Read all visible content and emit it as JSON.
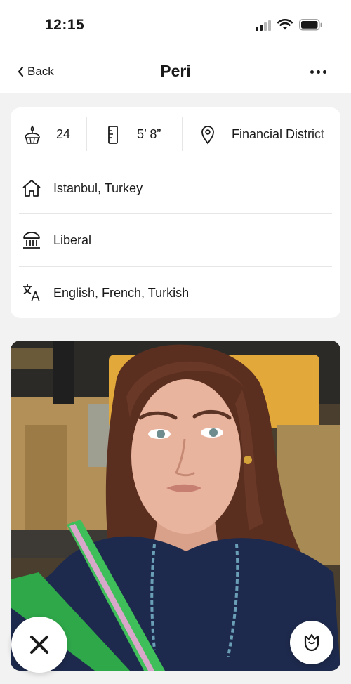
{
  "status_bar": {
    "time": "12:15",
    "icons": [
      "signal-icon",
      "wifi-icon",
      "battery-icon"
    ]
  },
  "nav": {
    "back_label": "Back",
    "title": "Peri",
    "more_icon": "more-dots-icon"
  },
  "info": {
    "age": {
      "icon": "cake-icon",
      "value": "24"
    },
    "height": {
      "icon": "ruler-icon",
      "value": "5’ 8”"
    },
    "location": {
      "icon": "location-pin-icon",
      "value": "Financial District"
    },
    "rows": [
      {
        "icon": "home-icon",
        "label": "Istanbul, Turkey"
      },
      {
        "icon": "politics-icon",
        "label": "Liberal"
      },
      {
        "icon": "language-icon",
        "label": "English, French, Turkish"
      }
    ]
  },
  "photo": {
    "subject": "profile-photo"
  },
  "actions": {
    "dismiss_icon": "close-x-icon",
    "rose_icon": "rose-icon"
  },
  "colors": {
    "background": "#f2f2f2",
    "card": "#ffffff",
    "text": "#1a1a1a",
    "divider": "#e6e6e6"
  }
}
